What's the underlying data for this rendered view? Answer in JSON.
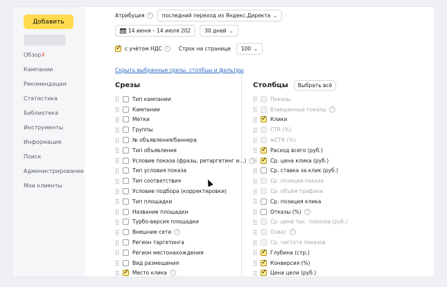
{
  "sidebar": {
    "add_label": "Добавить",
    "items": [
      {
        "label": "Обзор",
        "badge": "β"
      },
      {
        "label": "Кампании"
      },
      {
        "label": "Рекомендации"
      },
      {
        "label": "Статистика"
      },
      {
        "label": "Библиотека"
      },
      {
        "label": "Инструменты"
      },
      {
        "label": "Информация"
      },
      {
        "label": "Поиск"
      },
      {
        "label": "Администрирование"
      },
      {
        "label": "Мои клиенты"
      }
    ]
  },
  "filters": {
    "attribution_label": "Атрибуция",
    "attribution_value": "последний переход из Яндекс.Директа",
    "date_range": "14 июня – 14 июля 202",
    "period_value": "30 дней",
    "vat_label": "с учётом НДС",
    "rows_label": "Строк на странице",
    "rows_value": "100",
    "hide_link": "Скрыть выбранные срезы, столбцы и фильтры"
  },
  "slices": {
    "title": "Срезы",
    "items": [
      {
        "label": "Тип кампании",
        "checked": false
      },
      {
        "label": "Кампании",
        "checked": false
      },
      {
        "label": "Метки",
        "checked": false
      },
      {
        "label": "Группы",
        "checked": false
      },
      {
        "label": "№ объявления/баннера",
        "checked": false
      },
      {
        "label": "Тип объявления",
        "checked": false
      },
      {
        "label": "Условие показа (фразы, ретаргетинг и...)",
        "checked": false,
        "help": true
      },
      {
        "label": "Тип условия показа",
        "checked": false
      },
      {
        "label": "Тип соответствия",
        "checked": false
      },
      {
        "label": "Условие подбора (корректировки)",
        "checked": false
      },
      {
        "label": "Тип площадки",
        "checked": false
      },
      {
        "label": "Название площадки",
        "checked": false
      },
      {
        "label": "Турбо-версия площадки",
        "checked": false
      },
      {
        "label": "Внешние сети",
        "checked": false,
        "help": true
      },
      {
        "label": "Регион таргетинга",
        "checked": false
      },
      {
        "label": "Регион местонахождения",
        "checked": false
      },
      {
        "label": "Вид размещения",
        "checked": false
      },
      {
        "label": "Место клика",
        "checked": true,
        "help": true
      }
    ]
  },
  "columns": {
    "title": "Столбцы",
    "select_all": "Выбрать всё",
    "items": [
      {
        "label": "Показы",
        "checked": false,
        "disabled": true
      },
      {
        "label": "Взвешенные показы",
        "checked": false,
        "disabled": true,
        "help": true
      },
      {
        "label": "Клики",
        "checked": true
      },
      {
        "label": "CTR (%)",
        "checked": false,
        "disabled": true
      },
      {
        "label": "wCTR (%)",
        "checked": false,
        "disabled": true
      },
      {
        "label": "Расход всего (руб.)",
        "checked": true
      },
      {
        "label": "Ср. цена клика (руб.)",
        "checked": true
      },
      {
        "label": "Ср. ставка за клик (руб.)",
        "checked": false
      },
      {
        "label": "Ср. позиция показа",
        "checked": false,
        "disabled": true
      },
      {
        "label": "Ср. объём трафика",
        "checked": false,
        "disabled": true
      },
      {
        "label": "Ср. позиция клика",
        "checked": false
      },
      {
        "label": "Отказы (%)",
        "checked": false,
        "help": true
      },
      {
        "label": "Ср. цена тыс. показов (руб.)",
        "checked": false,
        "disabled": true
      },
      {
        "label": "Охват",
        "checked": false,
        "disabled": true,
        "help": true
      },
      {
        "label": "Ср. частота показов",
        "checked": false,
        "disabled": true
      },
      {
        "label": "Глубина (стр.)",
        "checked": true
      },
      {
        "label": "Конверсия (%)",
        "checked": true
      },
      {
        "label": "Цена цели (руб.)",
        "checked": true
      }
    ]
  }
}
